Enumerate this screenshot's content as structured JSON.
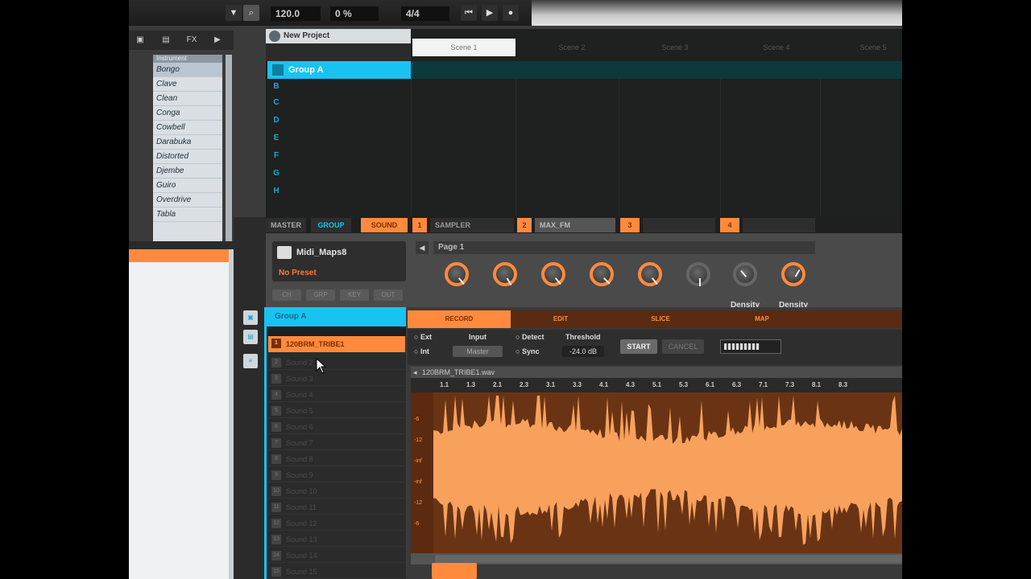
{
  "topbar": {
    "tempo": "120.0",
    "cpu": "0 %",
    "signature": "4/4",
    "search_icon": "search-icon",
    "rewind_icon": "rewind-icon",
    "play_icon": "play-icon",
    "record_icon": "record-icon"
  },
  "browser": {
    "tabs": [
      {
        "label": "▣"
      },
      {
        "label": "▤"
      },
      {
        "label": "FX"
      },
      {
        "label": "▶"
      }
    ],
    "tag_header": "Instrument",
    "tags": [
      "Bongo",
      "Clave",
      "Clean",
      "Conga",
      "Cowbell",
      "Darabuka",
      "Distorted",
      "Djembe",
      "Guiro",
      "Overdrive",
      "Tabla"
    ],
    "result_markers": [
      "",
      "",
      "",
      "",
      "",
      "",
      "",
      "",
      ""
    ]
  },
  "arrange": {
    "project_name": "New Project",
    "group_name": "Group A",
    "group_letters": [
      "A",
      "B",
      "C",
      "D",
      "E",
      "F",
      "G",
      "H"
    ],
    "scenes": [
      "Scene 1",
      "Scene 2",
      "Scene 3",
      "Scene 4",
      "Scene 5"
    ]
  },
  "tabstrip": {
    "master": "MASTER",
    "group": "GROUP",
    "sound": "SOUND",
    "sampler": "SAMPLER",
    "insert": "MAX_FM"
  },
  "plugin": {
    "preset_name": "Midi_Maps8",
    "preset_sub": "No Preset",
    "buttons": [
      "CH",
      "GRP",
      "KEY",
      "OUT"
    ],
    "page": "Page 1",
    "knob_labels": [
      "",
      "",
      "",
      "",
      "",
      "",
      "Density",
      "Density"
    ]
  },
  "sounds": {
    "group_label": "Group A",
    "selected": "120BRM_TRIBE1",
    "rows": [
      {
        "num": "2",
        "name": "Sound 2"
      },
      {
        "num": "3",
        "name": "Sound 3"
      },
      {
        "num": "4",
        "name": "Sound 4"
      },
      {
        "num": "5",
        "name": "Sound 5"
      },
      {
        "num": "6",
        "name": "Sound 6"
      },
      {
        "num": "7",
        "name": "Sound 7"
      },
      {
        "num": "8",
        "name": "Sound 8"
      },
      {
        "num": "9",
        "name": "Sound 9"
      },
      {
        "num": "10",
        "name": "Sound 10"
      },
      {
        "num": "11",
        "name": "Sound 11"
      },
      {
        "num": "12",
        "name": "Sound 12"
      },
      {
        "num": "13",
        "name": "Sound 13"
      },
      {
        "num": "14",
        "name": "Sound 14"
      },
      {
        "num": "15",
        "name": "Sound 15"
      }
    ]
  },
  "sampler": {
    "tabs": [
      "RECORD",
      "EDIT",
      "SLICE",
      "MAP"
    ],
    "ext": "Ext",
    "int": "Int",
    "input_label": "Input",
    "input_value": "Master",
    "detect": "Detect",
    "sync": "Sync",
    "threshold_label": "Threshold",
    "threshold_value": "-24.0 dB",
    "start": "START",
    "cancel": "CANCEL",
    "sample_name": "120BRM_TRIBE1.wav",
    "ruler": [
      "1.1",
      "1.3",
      "2.1",
      "2.3",
      "3.1",
      "3.3",
      "4.1",
      "4.3",
      "5.1",
      "5.3",
      "6.1",
      "6.3",
      "7.1",
      "7.3",
      "8.1",
      "8.3"
    ],
    "db_labels": [
      "-6",
      "-12",
      "-inf",
      "-inf",
      "-12",
      "-6"
    ]
  },
  "colors": {
    "accent_orange": "#ff8a3d",
    "accent_cyan": "#18c3f2",
    "wave": "#f7a15c"
  }
}
